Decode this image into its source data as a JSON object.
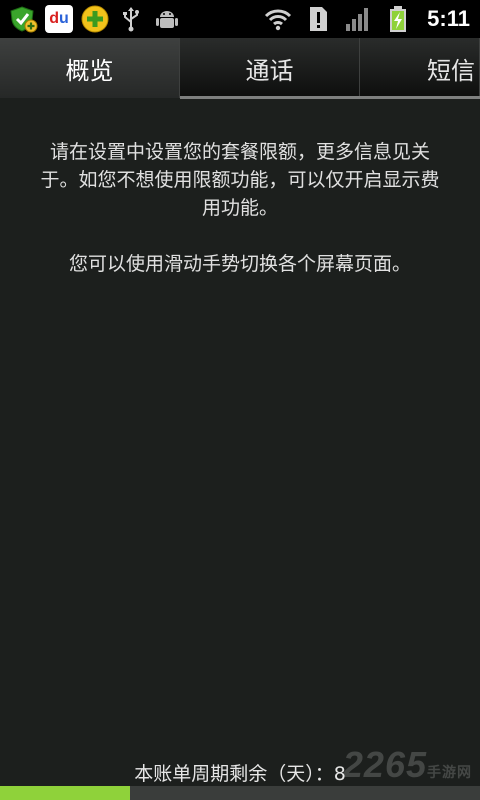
{
  "statusbar": {
    "left_icons": [
      "shield-plus-icon",
      "baidu-du-icon",
      "green-plus-app-icon",
      "usb-icon",
      "android-icon"
    ],
    "du_text": {
      "d": "d",
      "u": "u"
    },
    "right_icons": [
      "wifi-icon",
      "alert-icon",
      "signal-icon",
      "battery-icon"
    ],
    "time": "5:11"
  },
  "tabs": [
    {
      "label": "概览",
      "active": true
    },
    {
      "label": "通话",
      "active": false
    },
    {
      "label": "短信",
      "active": false
    }
  ],
  "main": {
    "message": "请在设置中设置您的套餐限额，更多信息见关于。如您不想使用限额功能，可以仅开启显示费用功能。",
    "hint": "您可以使用滑动手势切换各个屏幕页面。"
  },
  "footer": {
    "cycle_remaining": "本账单周期剩余（天）：8",
    "cycle_progress": 0.27
  },
  "watermark": {
    "text": "2265",
    "sub": "手游网"
  },
  "colors": {
    "accent": "#8fd23a",
    "background": "#1c1f1d"
  }
}
